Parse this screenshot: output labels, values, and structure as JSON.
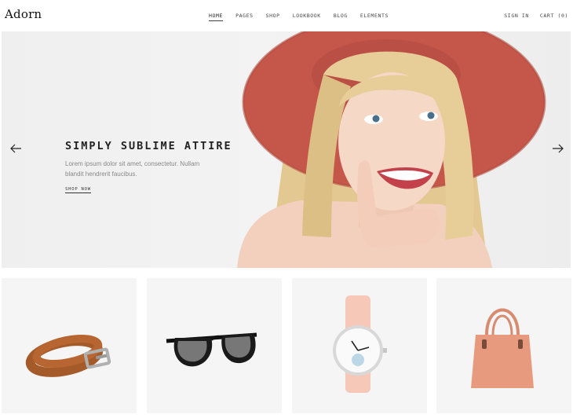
{
  "brand": {
    "logo": "Adorn"
  },
  "nav": {
    "items": [
      {
        "label": "HOME",
        "active": true
      },
      {
        "label": "PAGES",
        "active": false
      },
      {
        "label": "SHOP",
        "active": false
      },
      {
        "label": "LOOKBOOK",
        "active": false
      },
      {
        "label": "BLOG",
        "active": false
      },
      {
        "label": "ELEMENTS",
        "active": false
      }
    ]
  },
  "header_right": {
    "sign_in": "SIGN IN",
    "cart": "CART (0)"
  },
  "hero": {
    "title": "SIMPLY SUBLIME ATTIRE",
    "description": "Lorem ipsum dolor sit amet, consectetur. Nullam blandit hendrerit faucibus.",
    "cta": "SHOP NOW",
    "prev_icon": "arrow-left-icon",
    "next_icon": "arrow-right-icon"
  },
  "products": [
    {
      "image": "belt-image"
    },
    {
      "image": "sunglasses-image"
    },
    {
      "image": "watch-image"
    },
    {
      "image": "handbag-image"
    }
  ],
  "colors": {
    "hat": "#c4574a",
    "hair": "#e2c48e",
    "skin": "#f3d3c1",
    "belt": "#a55a2a",
    "watch_strap": "#f6c8b8",
    "bag": "#e89a7e",
    "card_bg": "#f5f5f5"
  }
}
